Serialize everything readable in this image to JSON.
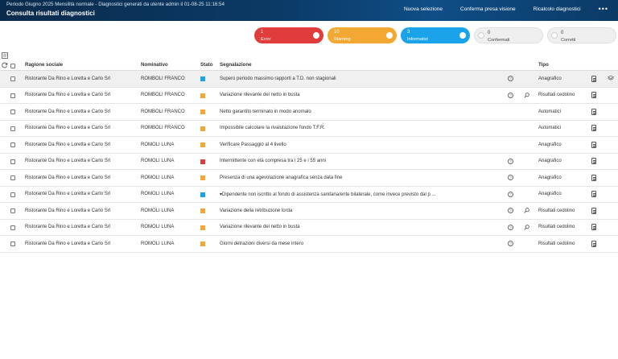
{
  "header": {
    "period": "Periodo Giugno 2025 Mensilità normale - Diagnostici generati da utente admin il 01-08-25 11:16:54",
    "title": "Consulta risultati diagnostici",
    "actions": [
      "Nuova selezione",
      "Conferma presa visione",
      "Ricalcolo diagnostici"
    ],
    "more": "•••"
  },
  "pills": [
    {
      "count": "1",
      "label": "Error",
      "color": "#e03c3c"
    },
    {
      "count": "10",
      "label": "Warning",
      "color": "#f2a833"
    },
    {
      "count": "3",
      "label": "Informativi",
      "color": "#1aa3e8"
    },
    {
      "count": "0",
      "label": "Confermati",
      "color": "#efefef"
    },
    {
      "count": "0",
      "label": "Corretti",
      "color": "#efefef"
    }
  ],
  "table": {
    "headers": {
      "ragione": "Ragione sociale",
      "nominativo": "Nominativo",
      "stato": "Stato",
      "segnalazione": "Segnalazione",
      "tipo": "Tipo"
    },
    "rows": [
      {
        "ragione": "Ristorante Da Rino e Loretta e Carlo Srl",
        "nominativo": "ROMBOLI FRANCO",
        "stato": "#1aa3e8",
        "segnalazione": "Supero periodo massimo rapporti a T.D. non stagionali",
        "info": true,
        "search": false,
        "tipo": "Anagrafico",
        "stack": true
      },
      {
        "ragione": "Ristorante Da Rino e Loretta e Carlo Srl",
        "nominativo": "ROMBOLI FRANCO",
        "stato": "#f2a833",
        "segnalazione": "Variazione rilevante del netto in busta",
        "info": true,
        "search": true,
        "tipo": "Risultati cedolino",
        "stack": false
      },
      {
        "ragione": "Ristorante Da Rino e Loretta e Carlo Srl",
        "nominativo": "ROMBOLI FRANCO",
        "stato": "#f2a833",
        "segnalazione": "Netto garantito terminato in modo anomalo",
        "info": false,
        "search": false,
        "tipo": "Automatici",
        "stack": false
      },
      {
        "ragione": "Ristorante Da Rino e Loretta e Carlo Srl",
        "nominativo": "ROMBOLI FRANCO",
        "stato": "#f2a833",
        "segnalazione": "Impossibile calcolare la rivalutazione fondo T.F.R.",
        "info": false,
        "search": false,
        "tipo": "Automatici",
        "stack": false
      },
      {
        "ragione": "Ristorante Da Rino e Loretta e Carlo Srl",
        "nominativo": "ROMOLI LUNA",
        "stato": "#f2a833",
        "segnalazione": "Verificare Passaggio al 4 livello",
        "info": false,
        "search": false,
        "tipo": "Anagrafico",
        "stack": false
      },
      {
        "ragione": "Ristorante Da Rino e Loretta e Carlo Srl",
        "nominativo": "ROMOLI LUNA",
        "stato": "#e03c3c",
        "segnalazione": "Intermittente con età compresa tra i 25 e i 55 anni",
        "info": true,
        "search": false,
        "tipo": "Anagrafico",
        "stack": false
      },
      {
        "ragione": "Ristorante Da Rino e Loretta e Carlo Srl",
        "nominativo": "ROMOLI LUNA",
        "stato": "#f2a833",
        "segnalazione": "Presenza di una agevolazione anagrafica senza data fine",
        "info": true,
        "search": false,
        "tipo": "Anagrafico",
        "stack": false
      },
      {
        "ragione": "Ristorante Da Rino e Loretta e Carlo Srl",
        "nominativo": "ROMOLI LUNA",
        "stato": "#1aa3e8",
        "segnalazione": "▾Dipendente non iscritto al fondo di assistenza sanitaria/ente bilaterale, come invece previsto dal p ...",
        "info": true,
        "search": false,
        "tipo": "Anagrafico",
        "stack": false
      },
      {
        "ragione": "Ristorante Da Rino e Loretta e Carlo Srl",
        "nominativo": "ROMOLI LUNA",
        "stato": "#f2a833",
        "segnalazione": "Variazione della retribuzione lorda",
        "info": true,
        "search": true,
        "tipo": "Risultati cedolino",
        "stack": false
      },
      {
        "ragione": "Ristorante Da Rino e Loretta e Carlo Srl",
        "nominativo": "ROMOLI LUNA",
        "stato": "#f2a833",
        "segnalazione": "Variazione rilevante del netto in busta",
        "info": true,
        "search": true,
        "tipo": "Risultati cedolino",
        "stack": false
      },
      {
        "ragione": "Ristorante Da Rino e Loretta e Carlo Srl",
        "nominativo": "ROMOLI LUNA",
        "stato": "#f2a833",
        "segnalazione": "Giorni detrazioni diversi da mese intero",
        "info": true,
        "search": false,
        "tipo": "Risultati cedolino",
        "stack": false
      }
    ]
  }
}
